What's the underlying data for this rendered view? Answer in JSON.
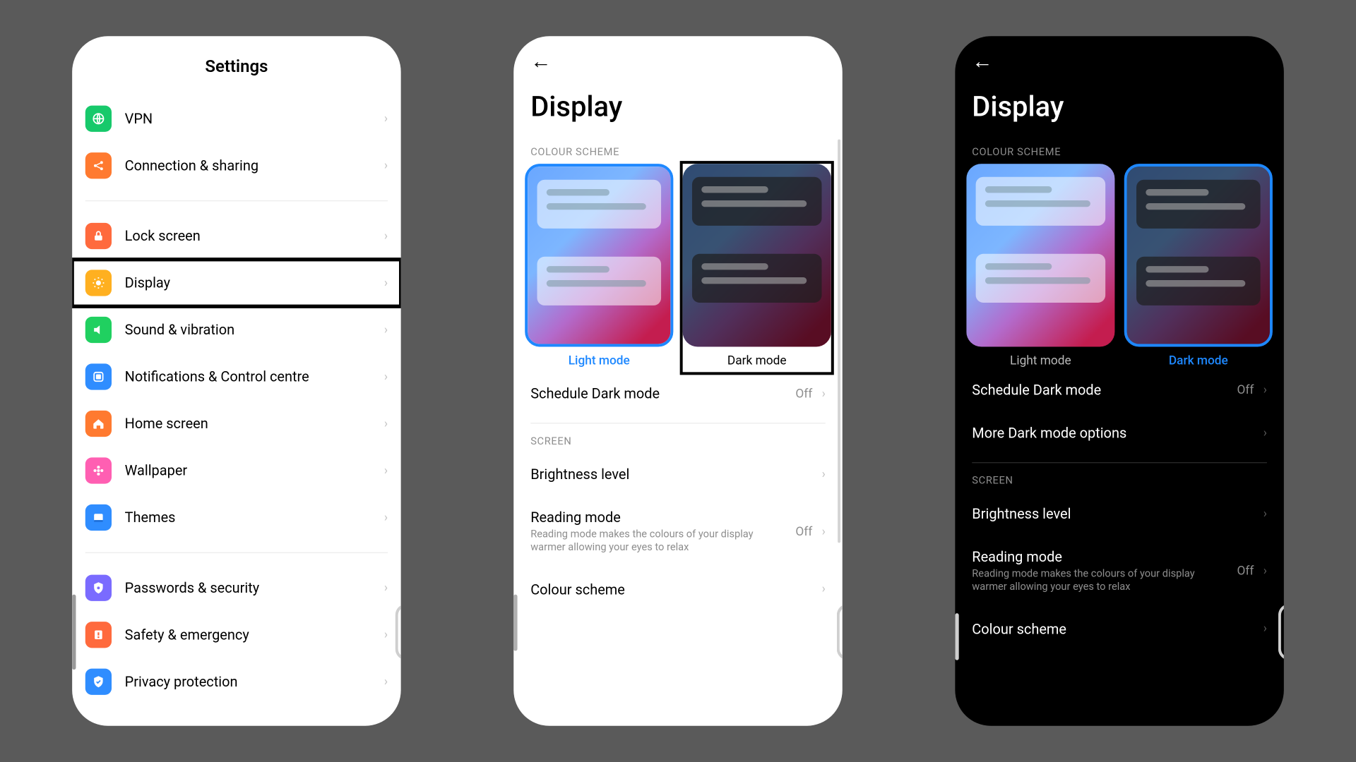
{
  "colors": {
    "accent": "#1e88ff",
    "page_bg": "#5a5a5a"
  },
  "s1": {
    "title": "Settings",
    "highlighted_item": "Display",
    "group1": [
      {
        "label": "VPN",
        "icon": "globe-icon",
        "bg": "#17c96b"
      },
      {
        "label": "Connection & sharing",
        "icon": "share-icon",
        "bg": "#ff7a30"
      }
    ],
    "group2": [
      {
        "label": "Lock screen",
        "icon": "lock-icon",
        "bg": "#ff6a3d"
      },
      {
        "label": "Display",
        "icon": "sun-icon",
        "bg": "#ffb020"
      },
      {
        "label": "Sound & vibration",
        "icon": "sound-icon",
        "bg": "#20d060"
      },
      {
        "label": "Notifications & Control centre",
        "icon": "notif-icon",
        "bg": "#2f8dff"
      },
      {
        "label": "Home screen",
        "icon": "home-icon",
        "bg": "#ff7a30"
      },
      {
        "label": "Wallpaper",
        "icon": "flower-icon",
        "bg": "#ff5fb2"
      },
      {
        "label": "Themes",
        "icon": "themes-icon",
        "bg": "#2f8dff"
      }
    ],
    "group3": [
      {
        "label": "Passwords & security",
        "icon": "shield-icon",
        "bg": "#7a6bff"
      },
      {
        "label": "Safety & emergency",
        "icon": "warning-icon",
        "bg": "#ff6a3d"
      },
      {
        "label": "Privacy protection",
        "icon": "privacy-icon",
        "bg": "#2f8dff"
      }
    ]
  },
  "s2": {
    "title": "Display",
    "section_colour": "COLOUR SCHEME",
    "modes": {
      "light": "Light mode",
      "dark": "Dark mode"
    },
    "selected": "light",
    "boxed": "dark",
    "rows": {
      "schedule": {
        "name": "Schedule Dark mode",
        "value": "Off"
      }
    },
    "section_screen": "SCREEN",
    "screen_rows": {
      "brightness": {
        "name": "Brightness level"
      },
      "reading": {
        "name": "Reading mode",
        "desc": "Reading mode makes the colours of your display warmer allowing your eyes to relax",
        "value": "Off"
      },
      "colour": {
        "name": "Colour scheme"
      }
    }
  },
  "s3": {
    "title": "Display",
    "section_colour": "COLOUR SCHEME",
    "modes": {
      "light": "Light mode",
      "dark": "Dark mode"
    },
    "selected": "dark",
    "rows": {
      "schedule": {
        "name": "Schedule Dark mode",
        "value": "Off"
      },
      "more": {
        "name": "More Dark mode options"
      }
    },
    "section_screen": "SCREEN",
    "screen_rows": {
      "brightness": {
        "name": "Brightness level"
      },
      "reading": {
        "name": "Reading mode",
        "desc": "Reading mode makes the colours of your display warmer allowing your eyes to relax",
        "value": "Off"
      },
      "colour": {
        "name": "Colour scheme"
      }
    }
  }
}
